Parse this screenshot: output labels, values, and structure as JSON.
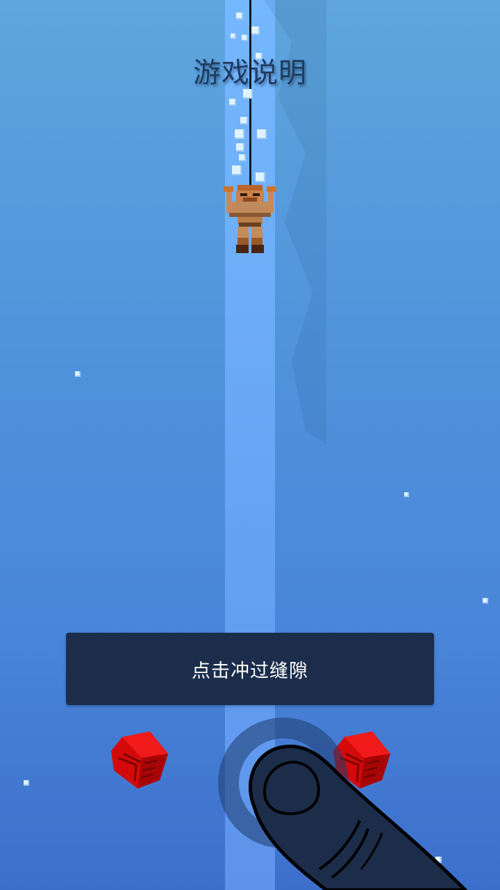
{
  "screen": {
    "title": "游戏说明",
    "tip": "点击冲过缝隙"
  },
  "icons": {
    "character": "climber-character-icon",
    "hazard": "red-spike-block-icon",
    "tap": "tap-finger-icon"
  },
  "colors": {
    "background_top": "#5ea6dd",
    "background_bottom": "#3c6fcb",
    "beam": "#6aa8f6",
    "tip_box": "#1b2d4b",
    "hazard": "#d40a0a",
    "finger": "#1c2d4a"
  }
}
